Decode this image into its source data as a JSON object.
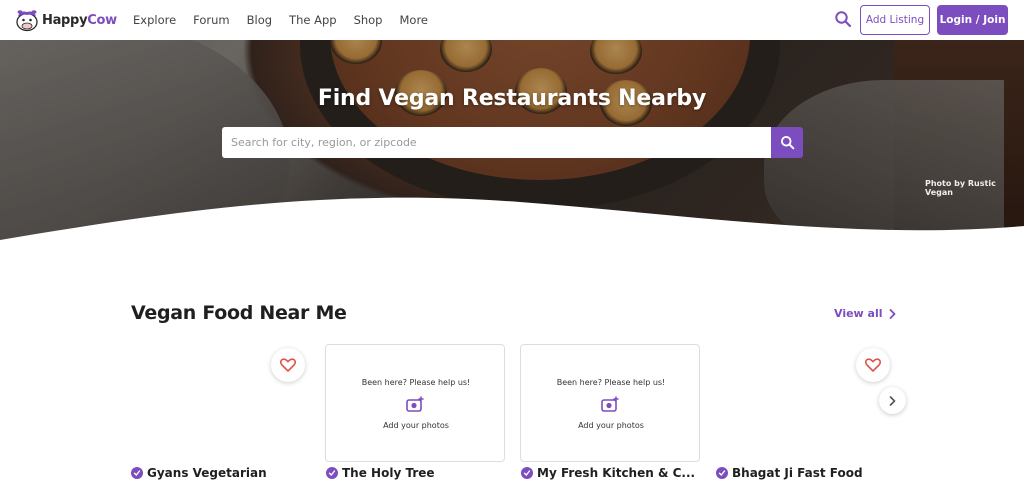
{
  "nav": {
    "logo_part1": "Happy",
    "logo_part2": "Cow",
    "menu": [
      "Explore",
      "Forum",
      "Blog",
      "The App",
      "Shop",
      "More"
    ],
    "search_icon": "search-icon",
    "add_listing": "Add Listing",
    "login": "Login / Join"
  },
  "hero": {
    "title": "Find Vegan Restaurants Nearby",
    "search_placeholder": "Search for city, region, or zipcode",
    "photo_credit": "Photo by Rustic Vegan"
  },
  "section": {
    "title": "Vegan Food Near Me",
    "view_all": "View all"
  },
  "cards": [
    {
      "name": "Gyans Vegetarian",
      "has_photo": false
    },
    {
      "name": "The Holy Tree",
      "help_text": "Been here? Please help us!",
      "add_photos": "Add your photos"
    },
    {
      "name": "My Fresh Kitchen & C...",
      "help_text": "Been here? Please help us!",
      "add_photos": "Add your photos"
    },
    {
      "name": "Bhagat Ji Fast Food",
      "has_photo": false
    }
  ],
  "colors": {
    "brand_purple": "#7c4dbe",
    "heart_red": "#e0564d"
  }
}
